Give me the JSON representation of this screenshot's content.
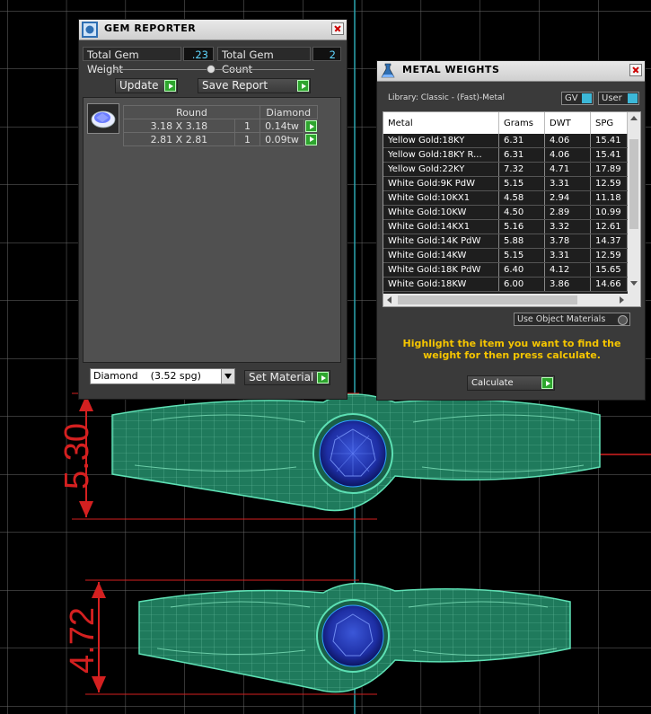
{
  "viewport": {
    "dimension_top": "5.30",
    "dimension_bottom": "4.72"
  },
  "gem_reporter": {
    "title": "GEM REPORTER",
    "total_weight_label": "Total Gem Weight",
    "total_weight_value": ".23",
    "total_count_label": "Total Gem Count",
    "total_count_value": "2",
    "update_label": "Update",
    "save_report_label": "Save Report",
    "table": {
      "headers": [
        "Round",
        "Diamond"
      ],
      "rows": [
        {
          "size": "3.18 X 3.18",
          "qty": "1",
          "weight": "0.14tw"
        },
        {
          "size": "2.81 X 2.81",
          "qty": "1",
          "weight": "0.09tw"
        }
      ]
    },
    "material_select": "Diamond    (3.52 spg)",
    "set_material_label": "Set Material"
  },
  "metal_weights": {
    "title": "METAL WEIGHTS",
    "library_label": "Library: Classic - (Fast)-Metal",
    "gv_label": "GV",
    "user_label": "User",
    "columns": [
      "Metal",
      "Grams",
      "DWT",
      "SPG"
    ],
    "rows": [
      [
        "Yellow Gold:18KY",
        "6.31",
        "4.06",
        "15.41"
      ],
      [
        "Yellow Gold:18KY R...",
        "6.31",
        "4.06",
        "15.41"
      ],
      [
        "Yellow Gold:22KY",
        "7.32",
        "4.71",
        "17.89"
      ],
      [
        "White Gold:9K PdW",
        "5.15",
        "3.31",
        "12.59"
      ],
      [
        "White Gold:10KX1",
        "4.58",
        "2.94",
        "11.18"
      ],
      [
        "White Gold:10KW",
        "4.50",
        "2.89",
        "10.99"
      ],
      [
        "White Gold:14KX1",
        "5.16",
        "3.32",
        "12.61"
      ],
      [
        "White Gold:14K PdW",
        "5.88",
        "3.78",
        "14.37"
      ],
      [
        "White Gold:14KW",
        "5.15",
        "3.31",
        "12.59"
      ],
      [
        "White Gold:18K PdW",
        "6.40",
        "4.12",
        "15.65"
      ],
      [
        "White Gold:18KW",
        "6.00",
        "3.86",
        "14.66"
      ]
    ],
    "use_object_materials_label": "Use Object Materials",
    "instruction": "Highlight the item you want to find the weight for then press calculate.",
    "calculate_label": "Calculate"
  }
}
